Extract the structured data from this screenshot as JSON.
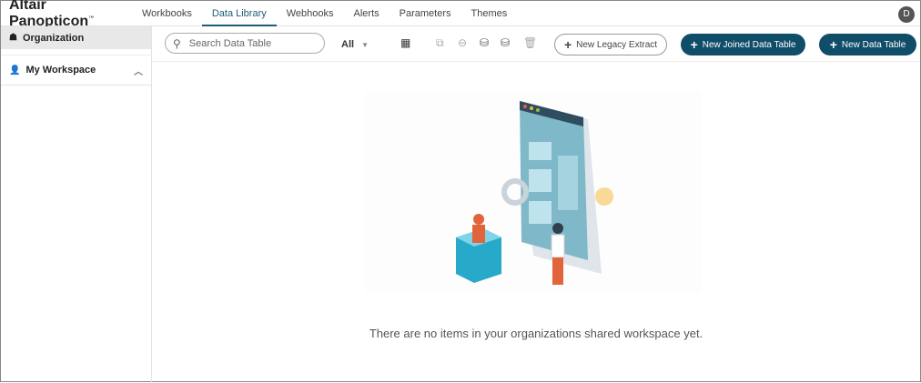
{
  "app": {
    "title": "Altair Panopticon",
    "tm": "™",
    "user_initial": "D"
  },
  "nav": {
    "tabs": [
      {
        "label": "Workbooks"
      },
      {
        "label": "Data Library"
      },
      {
        "label": "Webhooks"
      },
      {
        "label": "Alerts"
      },
      {
        "label": "Parameters"
      },
      {
        "label": "Themes"
      }
    ]
  },
  "sidebar": {
    "organization": "Organization",
    "my_workspace": "My Workspace"
  },
  "toolbar": {
    "search_placeholder": "Search Data Table",
    "filter_value": "All",
    "new_legacy": "New Legacy Extract",
    "new_joined": "New Joined Data Table",
    "new_table": "New Data Table"
  },
  "colors": {
    "accent": "#0f4d68"
  },
  "main": {
    "empty_message": "There are no items in your organizations shared workspace yet."
  }
}
